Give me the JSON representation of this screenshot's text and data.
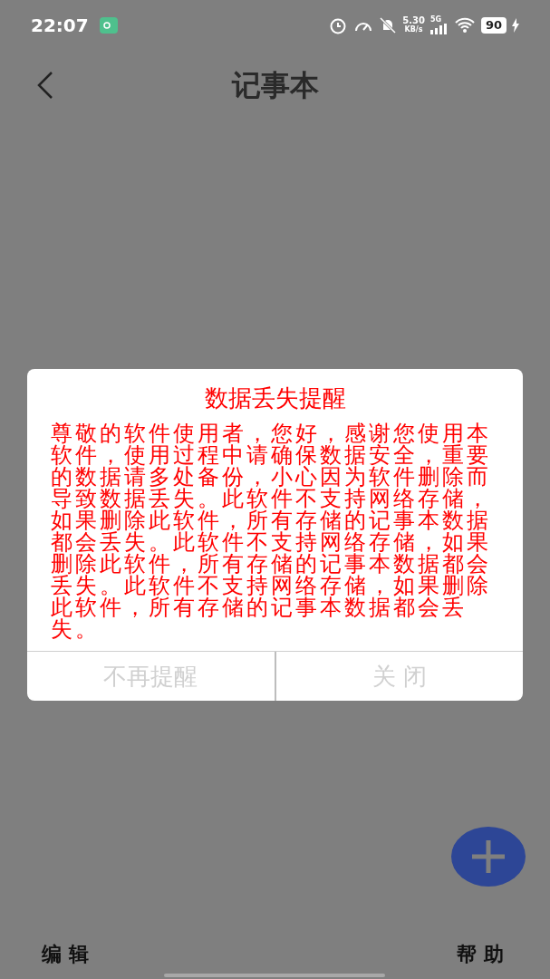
{
  "status_bar": {
    "time": "22:07",
    "net_speed": "5.30",
    "net_unit": "KB/s",
    "network": "5G",
    "battery": "90",
    "charging": true
  },
  "header": {
    "title": "记事本"
  },
  "dialog": {
    "title": "数据丢失提醒",
    "message": "尊敬的软件使用者，您好，感谢您使用本软件，使用过程中请确保数据安全，重要的数据请多处备份，小心因为软件删除而导致数据丢失。此软件不支持网络存储，如果删除此软件，所有存储的记事本数据都会丢失。此软件不支持网络存储，如果删除此软件，所有存储的记事本数据都会丢失。此软件不支持网络存储，如果删除此软件，所有存储的记事本数据都会丢失。",
    "buttons": [
      {
        "label": "不再提醒",
        "disabled": true
      },
      {
        "label": "关 闭",
        "disabled": true
      }
    ]
  },
  "bottom_bar": {
    "left": "编 辑",
    "right": "帮 助"
  }
}
